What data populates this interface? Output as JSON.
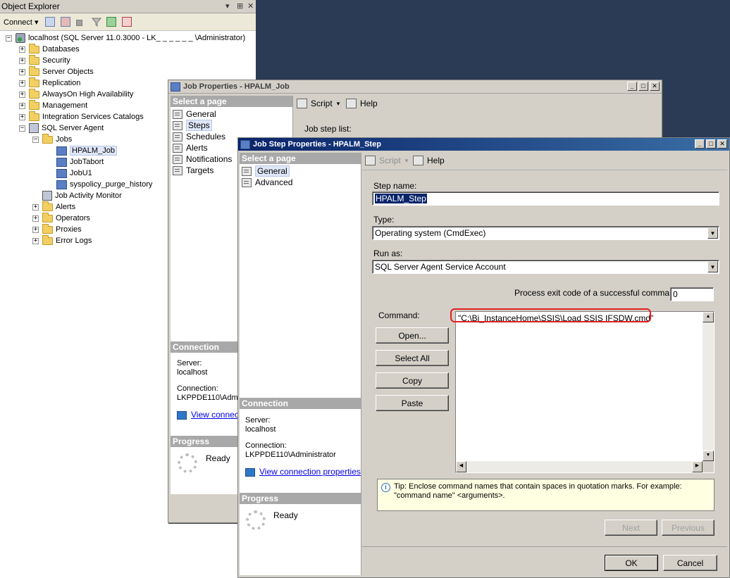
{
  "object_explorer": {
    "title": "Object Explorer",
    "title_buttons": [
      "▾",
      "⊞",
      "✕"
    ],
    "connect_label": "Connect ▾",
    "tree": [
      {
        "label": "localhost (SQL Server 11.0.3000 - LK_ _ _ _ _ _ \\Administrator)",
        "level": 0,
        "icon": "server-icon",
        "expander": "−"
      },
      {
        "label": "Databases",
        "level": 1,
        "icon": "folder-icon",
        "expander": "+"
      },
      {
        "label": "Security",
        "level": 1,
        "icon": "folder-icon",
        "expander": "+"
      },
      {
        "label": "Server Objects",
        "level": 1,
        "icon": "folder-icon",
        "expander": "+"
      },
      {
        "label": "Replication",
        "level": 1,
        "icon": "folder-icon",
        "expander": "+"
      },
      {
        "label": "AlwaysOn High Availability",
        "level": 1,
        "icon": "folder-icon",
        "expander": "+"
      },
      {
        "label": "Management",
        "level": 1,
        "icon": "folder-icon",
        "expander": "+"
      },
      {
        "label": "Integration Services Catalogs",
        "level": 1,
        "icon": "folder-icon",
        "expander": "+"
      },
      {
        "label": "SQL Server Agent",
        "level": 1,
        "icon": "agent-icon",
        "expander": "−"
      },
      {
        "label": "Jobs",
        "level": 2,
        "icon": "folder-icon",
        "expander": "−"
      },
      {
        "label": "HPALM_Job",
        "level": 3,
        "icon": "job-icon",
        "expander": "",
        "selected": true
      },
      {
        "label": "JobTabort",
        "level": 3,
        "icon": "job-icon",
        "expander": ""
      },
      {
        "label": "JobU1",
        "level": 3,
        "icon": "job-icon",
        "expander": ""
      },
      {
        "label": "syspolicy_purge_history",
        "level": 3,
        "icon": "job-icon",
        "expander": ""
      },
      {
        "label": "Job Activity Monitor",
        "level": 2,
        "icon": "monitor-icon",
        "expander": ""
      },
      {
        "label": "Alerts",
        "level": 2,
        "icon": "folder-icon",
        "expander": "+"
      },
      {
        "label": "Operators",
        "level": 2,
        "icon": "folder-icon",
        "expander": "+"
      },
      {
        "label": "Proxies",
        "level": 2,
        "icon": "folder-icon",
        "expander": "+"
      },
      {
        "label": "Error Logs",
        "level": 2,
        "icon": "folder-icon",
        "expander": "+"
      }
    ]
  },
  "job_window": {
    "title": "Job Properties - HPALM_Job",
    "select_page": "Select a page",
    "pages": [
      "General",
      "Steps",
      "Schedules",
      "Alerts",
      "Notifications",
      "Targets"
    ],
    "toolbar": {
      "script": "Script",
      "help": "Help"
    },
    "job_step_list": "Job step list:",
    "connection_head": "Connection",
    "server_label": "Server:",
    "server_value": "localhost",
    "connection_label": "Connection:",
    "connection_value": "LKPPDE110\\Adm",
    "view_connection": "View connec",
    "progress_head": "Progress",
    "progress_status": "Ready"
  },
  "step_window": {
    "title": "Job Step Properties - HPALM_Step",
    "select_page": "Select a page",
    "pages": [
      "General",
      "Advanced"
    ],
    "toolbar": {
      "script": "Script",
      "help": "Help"
    },
    "step_name_label": "Step name:",
    "step_name_value": "HPALM_Step",
    "type_label": "Type:",
    "type_value": "Operating system (CmdExec)",
    "run_as_label": "Run as:",
    "run_as_value": "SQL Server Agent Service Account",
    "exit_code_label": "Process exit code of a successful command:",
    "exit_code_value": "0",
    "command_label": "Command:",
    "command_value": "\"C:\\Bi_InstanceHome\\SSIS\\Load SSIS IFSDW.cmd\"",
    "buttons": {
      "open": "Open...",
      "select_all": "Select All",
      "copy": "Copy",
      "paste": "Paste"
    },
    "tip": "Tip: Enclose command names that contain spaces in quotation marks. For example: \"command name\" <arguments>.",
    "next": "Next",
    "previous": "Previous",
    "ok": "OK",
    "cancel": "Cancel",
    "connection_head": "Connection",
    "server_label": "Server:",
    "server_value": "localhost",
    "connection_label": "Connection:",
    "connection_value": "LKPPDE110\\Administrator",
    "view_connection": "View connection properties",
    "progress_head": "Progress",
    "progress_status": "Ready"
  },
  "colors": {
    "highlight": "#e02020",
    "accent": "#0a246a"
  }
}
